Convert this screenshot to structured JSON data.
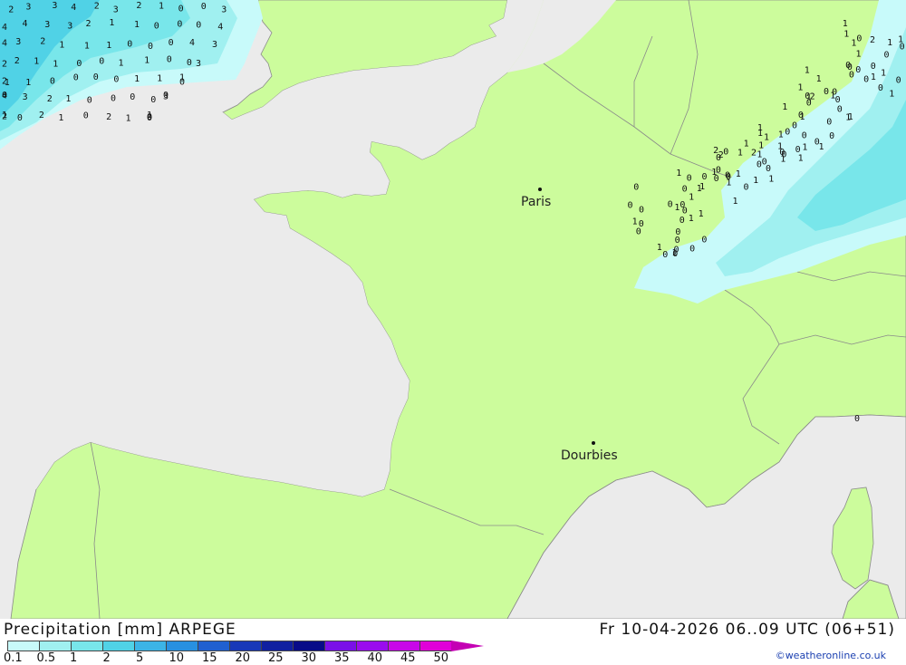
{
  "map": {
    "sea_color": "#ebebeb",
    "land_color": "#ccfc9c",
    "border_color": "#8a8a8a",
    "cities": [
      {
        "name": "Paris"
      },
      {
        "name": "Dourbies"
      }
    ],
    "precip_numbers_nw": [
      "2",
      "3",
      "3",
      "4",
      "2",
      "3",
      "2",
      "1",
      "0",
      "0",
      "3",
      "4",
      "4",
      "3",
      "3",
      "2",
      "1",
      "1",
      "0",
      "0",
      "0",
      "4",
      "4",
      "3",
      "2",
      "1",
      "1",
      "1",
      "0",
      "0",
      "0",
      "4",
      "3",
      "2",
      "2",
      "1",
      "1",
      "0",
      "0",
      "1",
      "1",
      "0",
      "0",
      "3",
      "2",
      "1",
      "1",
      "0",
      "0",
      "0",
      "0",
      "1",
      "1",
      "1",
      "0",
      "0",
      "4",
      "3",
      "2",
      "1",
      "0",
      "0",
      "0",
      "0",
      "0",
      "3",
      "2",
      "1",
      "0",
      "2",
      "1",
      "0",
      "2",
      "1",
      "1",
      "0",
      "0"
    ],
    "precip_numbers_ne": [
      "0",
      "0",
      "0",
      "1",
      "0",
      "1",
      "0",
      "1",
      "1",
      "2",
      "1",
      "0",
      "0",
      "1",
      "0",
      "1",
      "1",
      "0",
      "1",
      "2",
      "0",
      "0",
      "1",
      "1",
      "0",
      "1",
      "0",
      "1",
      "0",
      "0",
      "0",
      "1",
      "1",
      "0",
      "1",
      "1",
      "1",
      "0",
      "0",
      "1",
      "0",
      "0",
      "1",
      "0",
      "1",
      "1",
      "0",
      "0",
      "0",
      "0",
      "0",
      "0",
      "1",
      "1",
      "1",
      "0",
      "1",
      "1",
      "0",
      "1",
      "0",
      "0",
      "2",
      "2",
      "1",
      "1",
      "0",
      "1",
      "1",
      "1",
      "0",
      "0",
      "1",
      "1",
      "1",
      "0",
      "2",
      "1",
      "1",
      "0",
      "0",
      "1",
      "1",
      "0",
      "0",
      "1",
      "0",
      "0",
      "0",
      "0",
      "0",
      "1",
      "1",
      "0",
      "0",
      "0",
      "0",
      "1",
      "1",
      "0",
      "0",
      "0",
      "1",
      "1",
      "0",
      "0",
      "0",
      "0",
      "0",
      "0"
    ]
  },
  "footer": {
    "title_left": "Precipitation [mm] ARPEGE",
    "title_right": "Fr 10-04-2026 06..09 UTC (06+51)",
    "credit": "©weatheronline.co.uk",
    "colorbar": {
      "colors": [
        "#c8fafa",
        "#a0f0f0",
        "#78e6ea",
        "#50d2e6",
        "#3cb4e6",
        "#2890e0",
        "#2060d0",
        "#1838b8",
        "#1020a0",
        "#080c88",
        "#7a10e8",
        "#9a0cee",
        "#c808e8",
        "#e000d8",
        "#c400b4"
      ],
      "labels": [
        "0.1",
        "0.5",
        "1",
        "2",
        "5",
        "10",
        "15",
        "20",
        "25",
        "30",
        "35",
        "40",
        "45",
        "50"
      ]
    }
  }
}
